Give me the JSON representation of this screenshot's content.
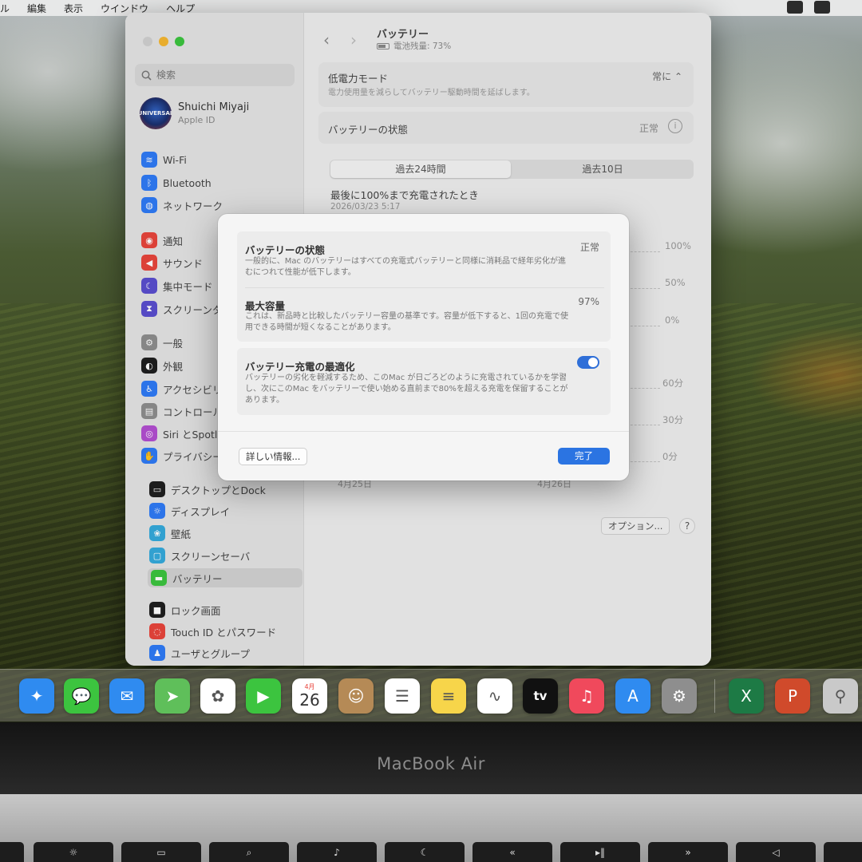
{
  "menubar": {
    "items": [
      "ル",
      "編集",
      "表示",
      "ウインドウ",
      "ヘルプ"
    ]
  },
  "sidebar": {
    "search_placeholder": "検索",
    "account": {
      "name": "Shuichi Miyaji",
      "sub": "Apple ID",
      "avatar_text": "UNIVERSAL"
    },
    "items": [
      {
        "label": "Wi-Fi",
        "icon": "wifi-icon",
        "color": "#2f7bf6"
      },
      {
        "label": "Bluetooth",
        "icon": "bluetooth-icon",
        "color": "#2f7bf6"
      },
      {
        "label": "ネットワーク",
        "icon": "globe-icon",
        "color": "#2f7bf6"
      },
      {
        "label": "通知",
        "icon": "bell-icon",
        "color": "#e8453c"
      },
      {
        "label": "サウンド",
        "icon": "speaker-icon",
        "color": "#e8453c"
      },
      {
        "label": "集中モード",
        "icon": "moon-icon",
        "color": "#5a4fcf"
      },
      {
        "label": "スクリーンタ",
        "icon": "hourglass-icon",
        "color": "#5a4fcf"
      },
      {
        "label": "一般",
        "icon": "gear-icon",
        "color": "#8e8e8e"
      },
      {
        "label": "外観",
        "icon": "appearance-icon",
        "color": "#1f1f1f"
      },
      {
        "label": "アクセシビリ",
        "icon": "accessibility-icon",
        "color": "#2f7bf6"
      },
      {
        "label": "コントロール",
        "icon": "control-center-icon",
        "color": "#8e8e8e"
      },
      {
        "label": "Siri とSpotl",
        "icon": "siri-icon",
        "color": "#b34fd1"
      },
      {
        "label": "プライバシー",
        "icon": "hand-icon",
        "color": "#2f7bf6"
      },
      {
        "label": "デスクトップとDock",
        "icon": "dock-icon",
        "color": "#1f1f1f"
      },
      {
        "label": "ディスプレイ",
        "icon": "sun-icon",
        "color": "#2f7bf6"
      },
      {
        "label": "壁紙",
        "icon": "flower-icon",
        "color": "#35aadc"
      },
      {
        "label": "スクリーンセーバ",
        "icon": "screensaver-icon",
        "color": "#35aadc"
      },
      {
        "label": "バッテリー",
        "icon": "battery-icon",
        "color": "#3cc43f"
      },
      {
        "label": "ロック画面",
        "icon": "lock-icon",
        "color": "#1f1f1f"
      },
      {
        "label": "Touch ID とパスワード",
        "icon": "fingerprint-icon",
        "color": "#e8453c"
      },
      {
        "label": "ユーザとグループ",
        "icon": "users-icon",
        "color": "#2f7bf6"
      }
    ]
  },
  "main": {
    "title": "バッテリー",
    "status": "電池残量: 73%",
    "low_power": {
      "title": "低電力モード",
      "desc": "電力使用量を減らしてバッテリー駆動時間を延ばします。",
      "value": "常に ⌃"
    },
    "health": {
      "title": "バッテリーの状態",
      "value": "正常"
    },
    "tabs": [
      "過去24時間",
      "過去10日"
    ],
    "last_full": {
      "title": "最後に100%まで充電されたとき",
      "date": "2026/03/23 5:17"
    },
    "level_axis": [
      "100%",
      "50%",
      "0%"
    ],
    "time_axis": [
      "60分",
      "30分",
      "0分"
    ],
    "dates": [
      "4月25日",
      "4月26日"
    ],
    "options_label": "オプション...",
    "help_label": "?"
  },
  "dialog": {
    "battery_state": {
      "title": "バッテリーの状態",
      "value": "正常",
      "desc": "一般的に、Mac のバッテリーはすべての充電式バッテリーと同様に消耗品で経年劣化が進むにつれて性能が低下します。"
    },
    "max_capacity": {
      "title": "最大容量",
      "value": "97%",
      "desc": "これは、新品時と比較したバッテリー容量の基準です。容量が低下すると、1回の充電で使用できる時間が短くなることがあります。"
    },
    "optimized_charging": {
      "title": "バッテリー充電の最適化",
      "enabled": true,
      "desc": "バッテリーの劣化を軽減するため、このMac が日ごろどのように充電されているかを学習し、次にこのMac をバッテリーで使い始める直前まで80%を超える充電を保留することがあります。"
    },
    "more_info_label": "詳しい情報...",
    "done_label": "完了"
  },
  "dock": {
    "apps": [
      {
        "name": "safari-icon",
        "color": "#2f8bf0",
        "glyph": "✦"
      },
      {
        "name": "messages-icon",
        "color": "#3cc43f",
        "glyph": "💬"
      },
      {
        "name": "mail-icon",
        "color": "#2f8bf0",
        "glyph": "✉"
      },
      {
        "name": "maps-icon",
        "color": "#5fbf5a",
        "glyph": "➤"
      },
      {
        "name": "photos-icon",
        "color": "#ffffff",
        "glyph": "✿"
      },
      {
        "name": "facetime-icon",
        "color": "#3cc43f",
        "glyph": "▶"
      },
      {
        "name": "calendar-icon",
        "color": "#ffffff",
        "glyph": ""
      },
      {
        "name": "contacts-icon",
        "color": "#b58a56",
        "glyph": "☺"
      },
      {
        "name": "reminders-icon",
        "color": "#ffffff",
        "glyph": "☰"
      },
      {
        "name": "notes-icon",
        "color": "#f7d54a",
        "glyph": "≡"
      },
      {
        "name": "freeform-icon",
        "color": "#ffffff",
        "glyph": "∿"
      },
      {
        "name": "appletv-icon",
        "color": "#111111",
        "glyph": ""
      },
      {
        "name": "music-icon",
        "color": "#f0495c",
        "glyph": "♫"
      },
      {
        "name": "appstore-icon",
        "color": "#2f8bf0",
        "glyph": "A"
      },
      {
        "name": "system-settings-icon",
        "color": "#8e8e8e",
        "glyph": "⚙"
      },
      {
        "name": "excel-icon",
        "color": "#1d7a45",
        "glyph": "X"
      },
      {
        "name": "powerpoint-icon",
        "color": "#d04a2b",
        "glyph": "P"
      },
      {
        "name": "archive-utility-icon",
        "color": "#c9c9c9",
        "glyph": "⚲"
      }
    ],
    "calendar_month": "4月",
    "calendar_day": "26",
    "appletv_label": "tv"
  },
  "device_label": "MacBook Air"
}
